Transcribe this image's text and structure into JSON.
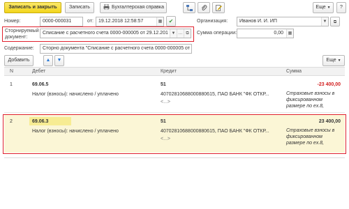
{
  "toolbar": {
    "save_close": "Записать и закрыть",
    "save": "Записать",
    "report": "Бухгалтерская справка",
    "more": "Еще",
    "help": "?"
  },
  "form": {
    "number_label": "Номер:",
    "number_value": "0000-000031",
    "date_label": "от:",
    "date_value": "19.12.2018 12:58:57",
    "org_label": "Организация:",
    "org_value": "Иванов И. И. ИП",
    "storno_label_1": "Сторнируемый",
    "storno_label_2": "документ:",
    "storno_value": "Списание с расчетного счета 0000-000005 от 29.12.201",
    "op_sum_label": "Сумма операции:",
    "op_sum_value": "0,00",
    "content_label": "Содержание:",
    "content_value": "Сторно документа \"Списание с расчетного счета 0000-000005 от"
  },
  "table_toolbar": {
    "add": "Добавить",
    "more": "Еще"
  },
  "table": {
    "headers": {
      "n": "N",
      "debit": "Дебет",
      "credit": "Кредит",
      "sum": "Сумма"
    },
    "rows": [
      {
        "n": "1",
        "debit_account": "69.06.5",
        "debit_sub": "Налог (взносы): начислено / уплачено",
        "credit_account": "51",
        "credit_sub1": "40702810688000880615, ПАО БАНК \"ФК ОТКР...",
        "credit_sub2": "<...>",
        "sum": "-23 400,00",
        "sum_note": "Страховые взносы в фиксированном размере по ex.8,"
      },
      {
        "n": "2",
        "debit_account": "69.06.3",
        "debit_sub": "Налог (взносы): начислено / уплачено",
        "credit_account": "51",
        "credit_sub1": "40702810688000880615, ПАО БАНК \"ФК ОТКР...",
        "credit_sub2": "<...>",
        "sum": "23 400,00",
        "sum_note": "Страховые взносы в фиксированном размере по ex.8,"
      }
    ]
  },
  "colors": {
    "accent_yellow": "#f5d81f",
    "highlight_row": "#fbf6d6",
    "red_border": "#e0202c",
    "negative": "#d21e1e"
  }
}
